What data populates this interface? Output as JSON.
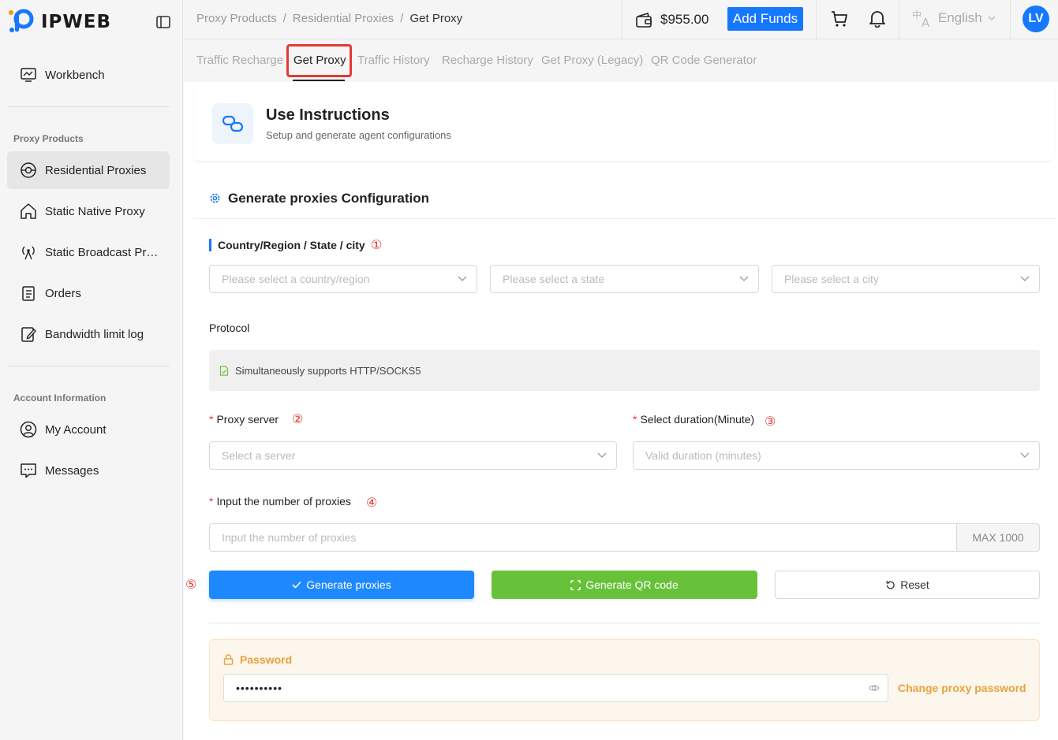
{
  "brand": {
    "name": "IPWEB"
  },
  "sidebar": {
    "workbench": "Workbench",
    "section_proxy": "Proxy Products",
    "items": [
      {
        "label": "Residential Proxies"
      },
      {
        "label": "Static Native Proxy"
      },
      {
        "label": "Static Broadcast Proxy"
      },
      {
        "label": "Orders"
      },
      {
        "label": "Bandwidth limit log"
      }
    ],
    "section_account": "Account Information",
    "account_items": [
      {
        "label": "My Account"
      },
      {
        "label": "Messages"
      }
    ]
  },
  "topbar": {
    "breadcrumb": [
      "Proxy Products",
      "Residential Proxies",
      "Get Proxy"
    ],
    "separator": "/",
    "balance": "$955.00",
    "add_funds": "Add Funds",
    "language": "English",
    "avatar_initials": "LV"
  },
  "tabs": [
    {
      "label": "Traffic Recharge"
    },
    {
      "label": "Get Proxy"
    },
    {
      "label": "Traffic History"
    },
    {
      "label": "Recharge History"
    },
    {
      "label": "Get Proxy (Legacy)"
    },
    {
      "label": "QR Code Generator"
    }
  ],
  "instructions": {
    "title": "Use Instructions",
    "subtitle": "Setup and generate agent configurations"
  },
  "generate": {
    "title": "Generate proxies Configuration",
    "location_label": "Country/Region / State / city",
    "country_placeholder": "Please select a country/region",
    "state_placeholder": "Please select a state",
    "city_placeholder": "Please select a city",
    "protocol_label": "Protocol",
    "protocol_text": "Simultaneously supports HTTP/SOCKS5",
    "server_label": "Proxy server",
    "server_placeholder": "Select a server",
    "duration_label": "Select duration(Minute)",
    "duration_placeholder": "Valid duration (minutes)",
    "count_label": "Input the number of proxies",
    "count_placeholder": "Input the number of proxies",
    "count_max": "MAX 1000",
    "required_mark": "*",
    "steps": [
      "①",
      "②",
      "③",
      "④",
      "⑤"
    ],
    "btn_generate": "Generate proxies",
    "btn_qr": "Generate QR code",
    "btn_reset": "Reset"
  },
  "password": {
    "title": "Password",
    "value": "••••••••••",
    "change_link": "Change proxy password"
  },
  "colors": {
    "accent": "#1677ff",
    "green": "#67c23a",
    "warning": "#e6a23c",
    "highlight": "#e53935"
  }
}
